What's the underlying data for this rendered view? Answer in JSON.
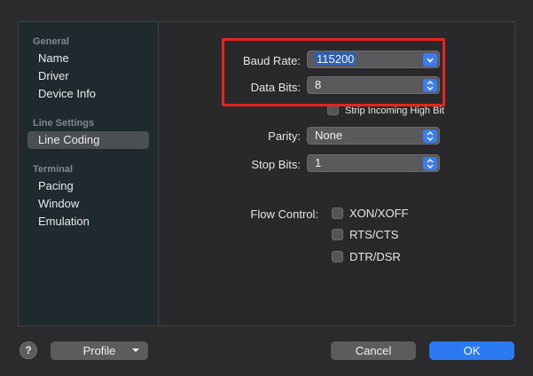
{
  "sidebar": {
    "groups": [
      {
        "header": "General",
        "items": [
          "Name",
          "Driver",
          "Device Info"
        ]
      },
      {
        "header": "Line Settings",
        "items": [
          "Line Coding"
        ]
      },
      {
        "header": "Terminal",
        "items": [
          "Pacing",
          "Window",
          "Emulation"
        ]
      }
    ],
    "selected": "Line Coding"
  },
  "form": {
    "baud_rate_label": "Baud Rate:",
    "baud_rate_value": "115200",
    "data_bits_label": "Data Bits:",
    "data_bits_value": "8",
    "strip_high_bit_label": "Strip Incoming High Bit",
    "parity_label": "Parity:",
    "parity_value": "None",
    "stop_bits_label": "Stop Bits:",
    "stop_bits_value": "1",
    "flow_control_label": "Flow Control:",
    "flow_options": [
      "XON/XOFF",
      "RTS/CTS",
      "DTR/DSR"
    ]
  },
  "footer": {
    "help_label": "?",
    "profile_label": "Profile",
    "cancel_label": "Cancel",
    "ok_label": "OK"
  },
  "colors": {
    "accent": "#2d79f3",
    "highlight_box": "#e0281e",
    "sidebar_bg": "#1f2a2e"
  }
}
